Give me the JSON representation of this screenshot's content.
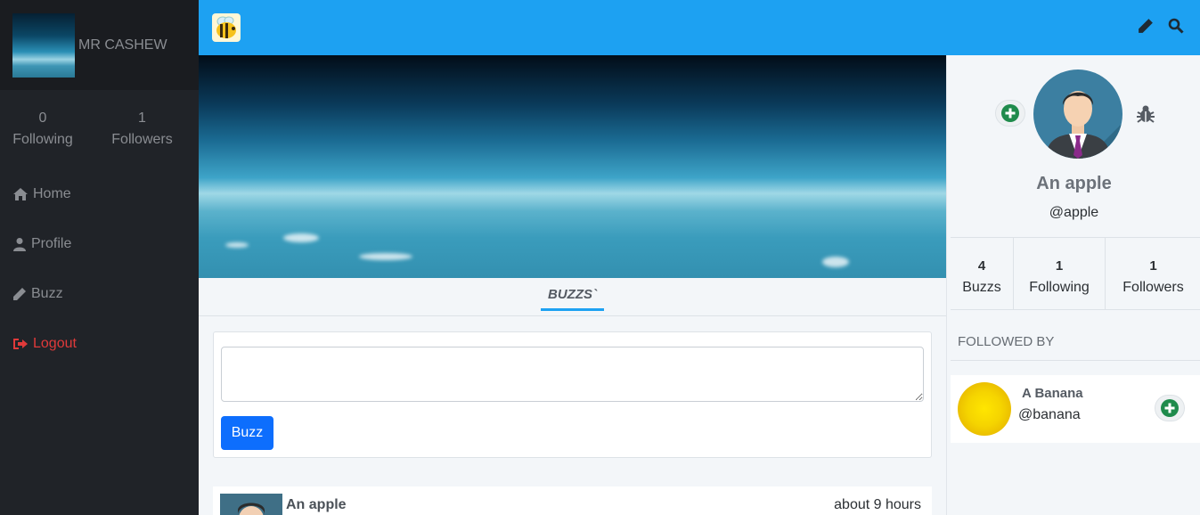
{
  "sidebar": {
    "username": "MR CASHEW",
    "stats": [
      {
        "value": "0",
        "label": "Following"
      },
      {
        "value": "1",
        "label": "Followers"
      }
    ],
    "nav": [
      {
        "label": "Home",
        "icon": "home-icon"
      },
      {
        "label": "Profile",
        "icon": "user-icon"
      },
      {
        "label": "Buzz",
        "icon": "pencil-icon"
      },
      {
        "label": "Logout",
        "icon": "logout-icon"
      }
    ]
  },
  "topbar": {
    "logo_icon": "bee-icon",
    "actions": [
      "pencil-icon",
      "search-icon"
    ],
    "color": "#1da1f2"
  },
  "main": {
    "tab_label": "BUZZS`",
    "compose": {
      "placeholder": "",
      "button_label": "Buzz"
    },
    "post": {
      "author": "An apple",
      "time": "about 9 hours"
    }
  },
  "profile": {
    "name": "An apple",
    "handle": "@apple",
    "stats": [
      {
        "value": "4",
        "label": "Buzzs"
      },
      {
        "value": "1",
        "label": "Following"
      },
      {
        "value": "1",
        "label": "Followers"
      }
    ],
    "followed_by_title": "FOLLOWED BY",
    "followers": [
      {
        "name": "A Banana",
        "handle": "@banana"
      }
    ]
  }
}
